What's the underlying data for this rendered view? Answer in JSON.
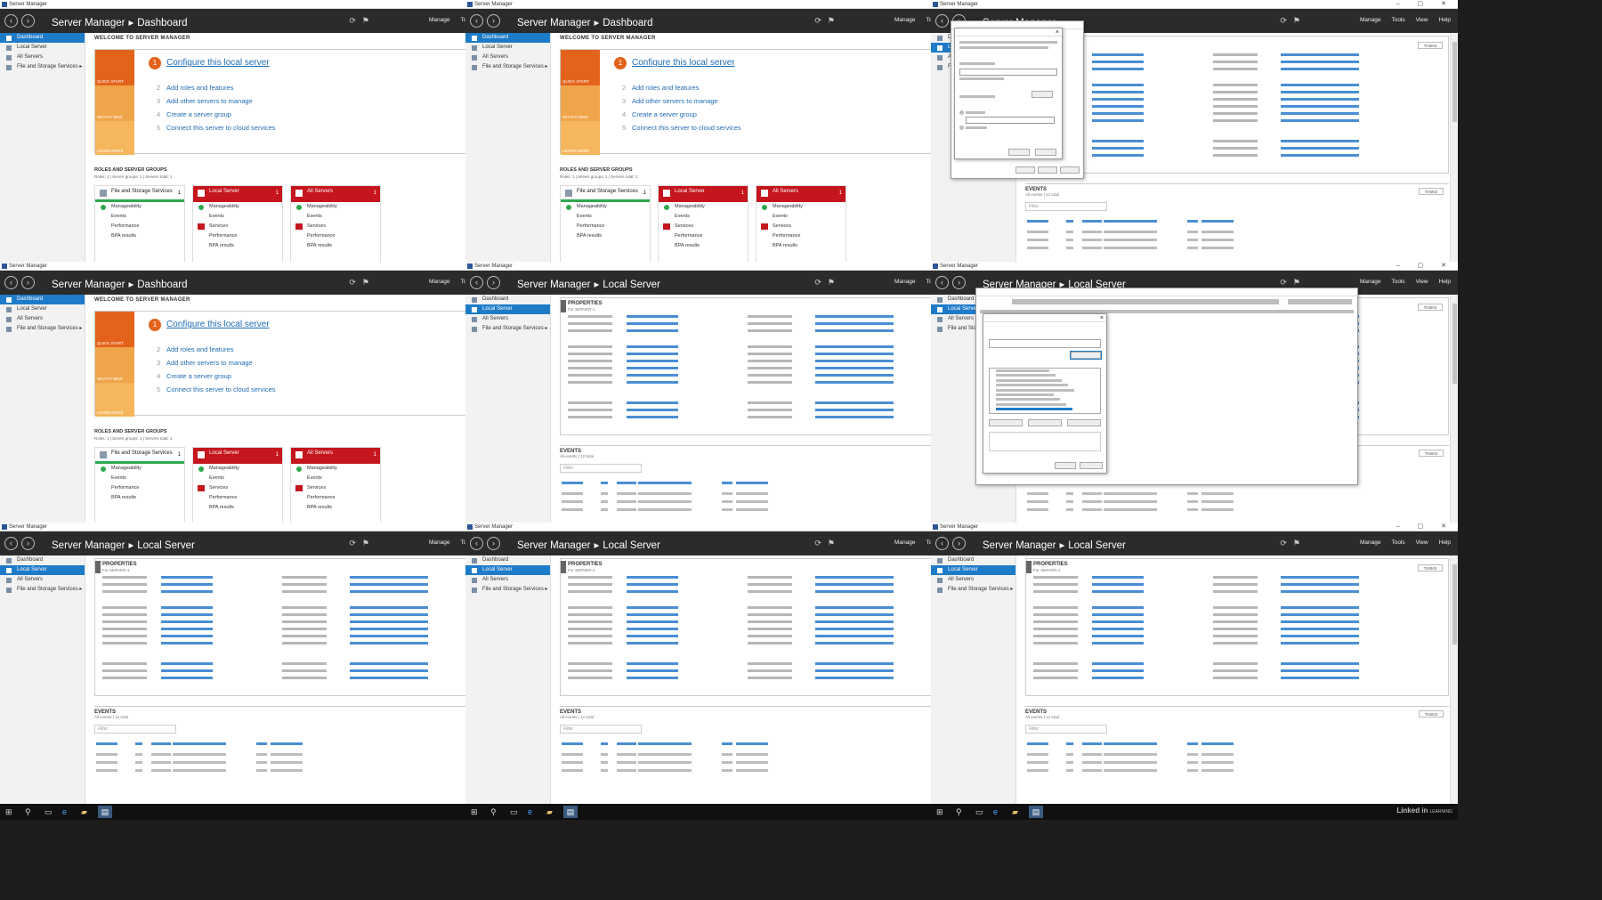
{
  "app_window_title": "Server Manager",
  "header": {
    "app_name": "Server Manager",
    "separator": "▸",
    "menu": [
      "Manage",
      "Tools",
      "View",
      "Help"
    ]
  },
  "sidebar": {
    "items": [
      "Dashboard",
      "Local Server",
      "All Servers",
      "File and Storage Services"
    ]
  },
  "dashboard": {
    "page": "Dashboard",
    "welcome": "WELCOME TO SERVER MANAGER",
    "quick_start": "QUICK START",
    "whats_new": "WHAT'S NEW",
    "learn_more": "LEARN MORE",
    "step1": "Configure this local server",
    "steps": [
      {
        "n": "2",
        "label": "Add roles and features"
      },
      {
        "n": "3",
        "label": "Add other servers to manage"
      },
      {
        "n": "4",
        "label": "Create a server group"
      },
      {
        "n": "5",
        "label": "Connect this server to cloud services"
      }
    ],
    "hide": "Hide",
    "roles_heading": "ROLES AND SERVER GROUPS",
    "roles_sub": "Roles: 1 | Server groups: 1 | Servers total: 1",
    "cards": [
      {
        "title": "File and Storage Services",
        "count": "1",
        "rows": [
          "Manageability",
          "Events",
          "Performance",
          "BPA results"
        ]
      },
      {
        "title": "Local Server",
        "count": "1",
        "rows": [
          "Manageability",
          "Events",
          "Services",
          "Performance",
          "BPA results"
        ]
      },
      {
        "title": "All Servers",
        "count": "1",
        "rows": [
          "Manageability",
          "Events",
          "Services",
          "Performance",
          "BPA results"
        ]
      }
    ]
  },
  "local_server": {
    "page": "Local Server",
    "properties": "PROPERTIES",
    "properties_for": "For SERVER-1",
    "tasks": "TASKS",
    "events": "EVENTS",
    "events_sub": "All events | 12 total",
    "filter": "Filter"
  },
  "taskbar": {
    "brand": "Linked in",
    "brand_sub": "LEARNING"
  },
  "tiles": [
    {
      "view": "dashboard",
      "page": "Dashboard",
      "active": 0
    },
    {
      "view": "dashboard",
      "page": "Dashboard",
      "active": 0
    },
    {
      "view": "local",
      "page": "",
      "active": 1,
      "dialog": "domain"
    },
    {
      "view": "dashboard",
      "page": "Dashboard",
      "active": 0
    },
    {
      "view": "local",
      "page": "Local Server",
      "active": 1
    },
    {
      "view": "local",
      "page": "Local Server",
      "active": 1,
      "dialog": "network"
    },
    {
      "view": "local",
      "page": "Local Server",
      "active": 1
    },
    {
      "view": "local",
      "page": "Local Server",
      "active": 1
    },
    {
      "view": "local",
      "page": "Local Server",
      "active": 1
    }
  ],
  "colors": {
    "header": "#2b2b2b",
    "accent": "#1e7bc8",
    "quick_start": "#e4631c",
    "alert": "#c4161c",
    "ok": "#2fa84f"
  },
  "icons": [
    "back-icon",
    "forward-icon",
    "refresh-icon",
    "flag-icon",
    "windows-start-icon",
    "search-icon",
    "task-view-icon",
    "edge-icon",
    "file-explorer-icon",
    "server-manager-icon"
  ]
}
